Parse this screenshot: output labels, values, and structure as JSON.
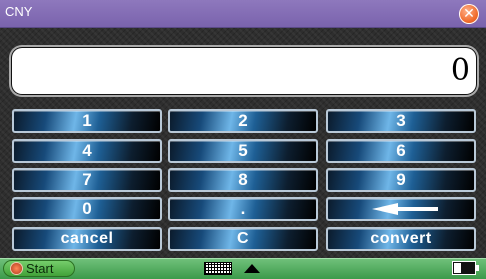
{
  "window": {
    "title": "CNY",
    "close_icon": "close-icon"
  },
  "display": {
    "value": "0"
  },
  "keys": {
    "one": "1",
    "two": "2",
    "three": "3",
    "four": "4",
    "five": "5",
    "six": "6",
    "seven": "7",
    "eight": "8",
    "nine": "9",
    "zero": "0",
    "dot": ".",
    "backspace_icon": "left-arrow-icon",
    "cancel": "cancel",
    "clear": "C",
    "convert": "convert"
  },
  "taskbar": {
    "start_label": "Start",
    "keyboard_icon": "keyboard-icon",
    "up_icon": "up-arrow-icon",
    "battery_icon": "battery-icon",
    "battery_level": 0.35
  },
  "colors": {
    "title_bar": "#8e78bd",
    "key_blue": "#6fb6e8",
    "taskbar_green": "#4fa95b",
    "close_orange": "#f06a2a"
  }
}
